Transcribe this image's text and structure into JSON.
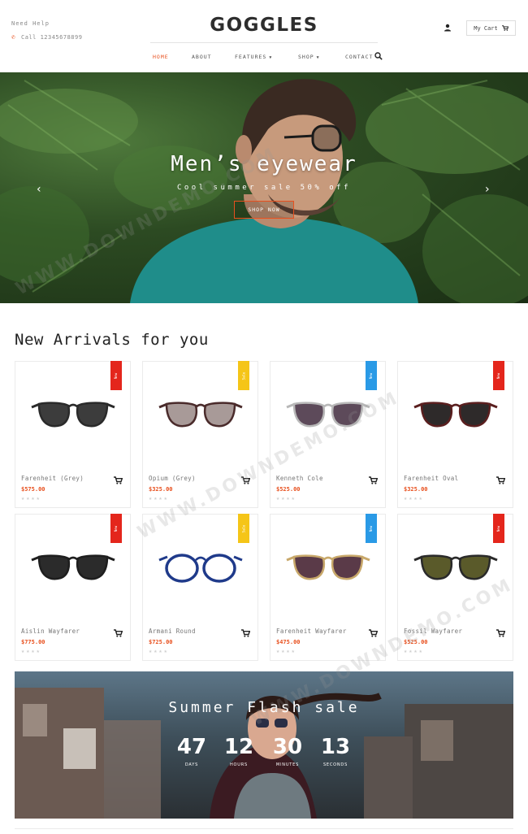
{
  "header": {
    "help_text": "Need Help",
    "call_text": "Call 12345678899",
    "logo": "GOGGLES",
    "cart_label": "My Cart",
    "nav": [
      {
        "label": "HOME",
        "active": true
      },
      {
        "label": "ABOUT",
        "active": false
      },
      {
        "label": "FEATURES",
        "active": false,
        "dropdown": true
      },
      {
        "label": "SHOP",
        "active": false,
        "dropdown": true
      },
      {
        "label": "CONTACT",
        "active": false
      }
    ]
  },
  "hero": {
    "title": "Men’s eyewear",
    "subtitle": "Cool summer sale 50% off",
    "button": "SHOP NOW",
    "prev_arrow": "‹",
    "next_arrow": "›"
  },
  "arrivals": {
    "title": "New Arrivals for you",
    "products": [
      {
        "name": "Farenheit (Grey)",
        "price": "$575.00",
        "badge": "New",
        "badge_color": "#e4261c",
        "frame": "#2a2a2a",
        "lens": "#3c3c3c"
      },
      {
        "name": "Opium (Grey)",
        "price": "$325.00",
        "badge": "Sale",
        "badge_color": "#f5c518",
        "frame": "#4a2b2b",
        "lens": "#a89a98"
      },
      {
        "name": "Kenneth Cole",
        "price": "$525.00",
        "badge": "New",
        "badge_color": "#2a9ae6",
        "frame": "#b8b8b8",
        "lens": "#5d4a5a"
      },
      {
        "name": "Farenheit Oval",
        "price": "$325.00",
        "badge": "New",
        "badge_color": "#e4261c",
        "frame": "#5a1f1f",
        "lens": "#2e2a2a"
      },
      {
        "name": "Aislin Wayfarer",
        "price": "$775.00",
        "badge": "New",
        "badge_color": "#e4261c",
        "frame": "#1e1e1e",
        "lens": "#2b2b2b"
      },
      {
        "name": "Armani Round",
        "price": "$725.00",
        "badge": "Sale",
        "badge_color": "#f5c518",
        "frame": "#1f3a8a",
        "lens": "#ffffff"
      },
      {
        "name": "Farenheit Wayfarer",
        "price": "$475.00",
        "badge": "New",
        "badge_color": "#2a9ae6",
        "frame": "#c8a86a",
        "lens": "#5a3a48"
      },
      {
        "name": "Fossil Wayfarer",
        "price": "$525.00",
        "badge": "New",
        "badge_color": "#e4261c",
        "frame": "#2a2a2a",
        "lens": "#5a5a2a"
      }
    ],
    "stars": "★★★★"
  },
  "flash": {
    "title": "Summer Flash sale",
    "timer": [
      {
        "value": "47",
        "label": "DAYS"
      },
      {
        "value": "12",
        "label": "HOURS"
      },
      {
        "value": "30",
        "label": "MINUTES"
      },
      {
        "value": "13",
        "label": "SECONDS"
      }
    ]
  },
  "watermark": "WWW.DOWNDEMO.COM",
  "colors": {
    "accent": "#e8501e"
  }
}
